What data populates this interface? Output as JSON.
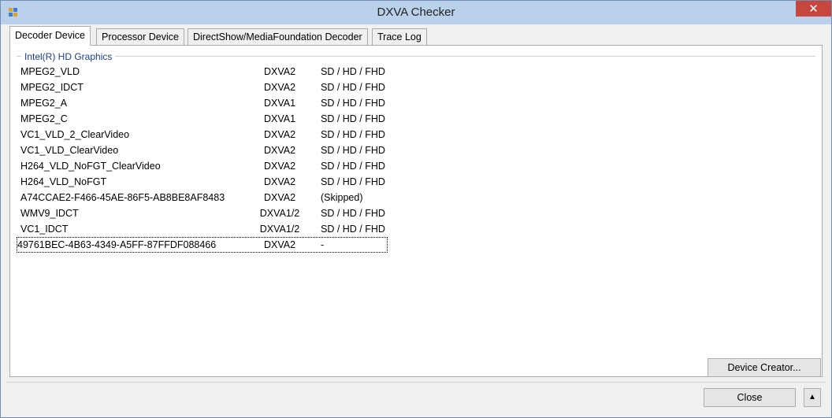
{
  "window": {
    "title": "DXVA Checker",
    "close_glyph": "✕",
    "icon": "app-icon"
  },
  "tabs": [
    {
      "label": "Decoder Device",
      "active": true
    },
    {
      "label": "Processor Device",
      "active": false
    },
    {
      "label": "DirectShow/MediaFoundation Decoder",
      "active": false
    },
    {
      "label": "Trace Log",
      "active": false
    }
  ],
  "group": {
    "label": "Intel(R) HD Graphics"
  },
  "decoders": [
    {
      "name": "MPEG2_VLD",
      "type": "DXVA2",
      "resolution": "SD / HD / FHD"
    },
    {
      "name": "MPEG2_IDCT",
      "type": "DXVA2",
      "resolution": "SD / HD / FHD"
    },
    {
      "name": "MPEG2_A",
      "type": "DXVA1",
      "resolution": "SD / HD / FHD"
    },
    {
      "name": "MPEG2_C",
      "type": "DXVA1",
      "resolution": "SD / HD / FHD"
    },
    {
      "name": "VC1_VLD_2_ClearVideo",
      "type": "DXVA2",
      "resolution": "SD / HD / FHD"
    },
    {
      "name": "VC1_VLD_ClearVideo",
      "type": "DXVA2",
      "resolution": "SD / HD / FHD"
    },
    {
      "name": "H264_VLD_NoFGT_ClearVideo",
      "type": "DXVA2",
      "resolution": "SD / HD / FHD"
    },
    {
      "name": "H264_VLD_NoFGT",
      "type": "DXVA2",
      "resolution": "SD / HD / FHD"
    },
    {
      "name": "A74CCAE2-F466-45AE-86F5-AB8BE8AF8483",
      "type": "DXVA2",
      "resolution": "(Skipped)"
    },
    {
      "name": "WMV9_IDCT",
      "type": "DXVA1/2",
      "resolution": "SD / HD / FHD"
    },
    {
      "name": "VC1_IDCT",
      "type": "DXVA1/2",
      "resolution": "SD / HD / FHD"
    },
    {
      "name": "49761BEC-4B63-4349-A5FF-87FFDF088466",
      "type": "DXVA2",
      "resolution": "-"
    }
  ],
  "buttons": {
    "device_creator": "Device Creator...",
    "close": "Close",
    "expand": "▲"
  }
}
